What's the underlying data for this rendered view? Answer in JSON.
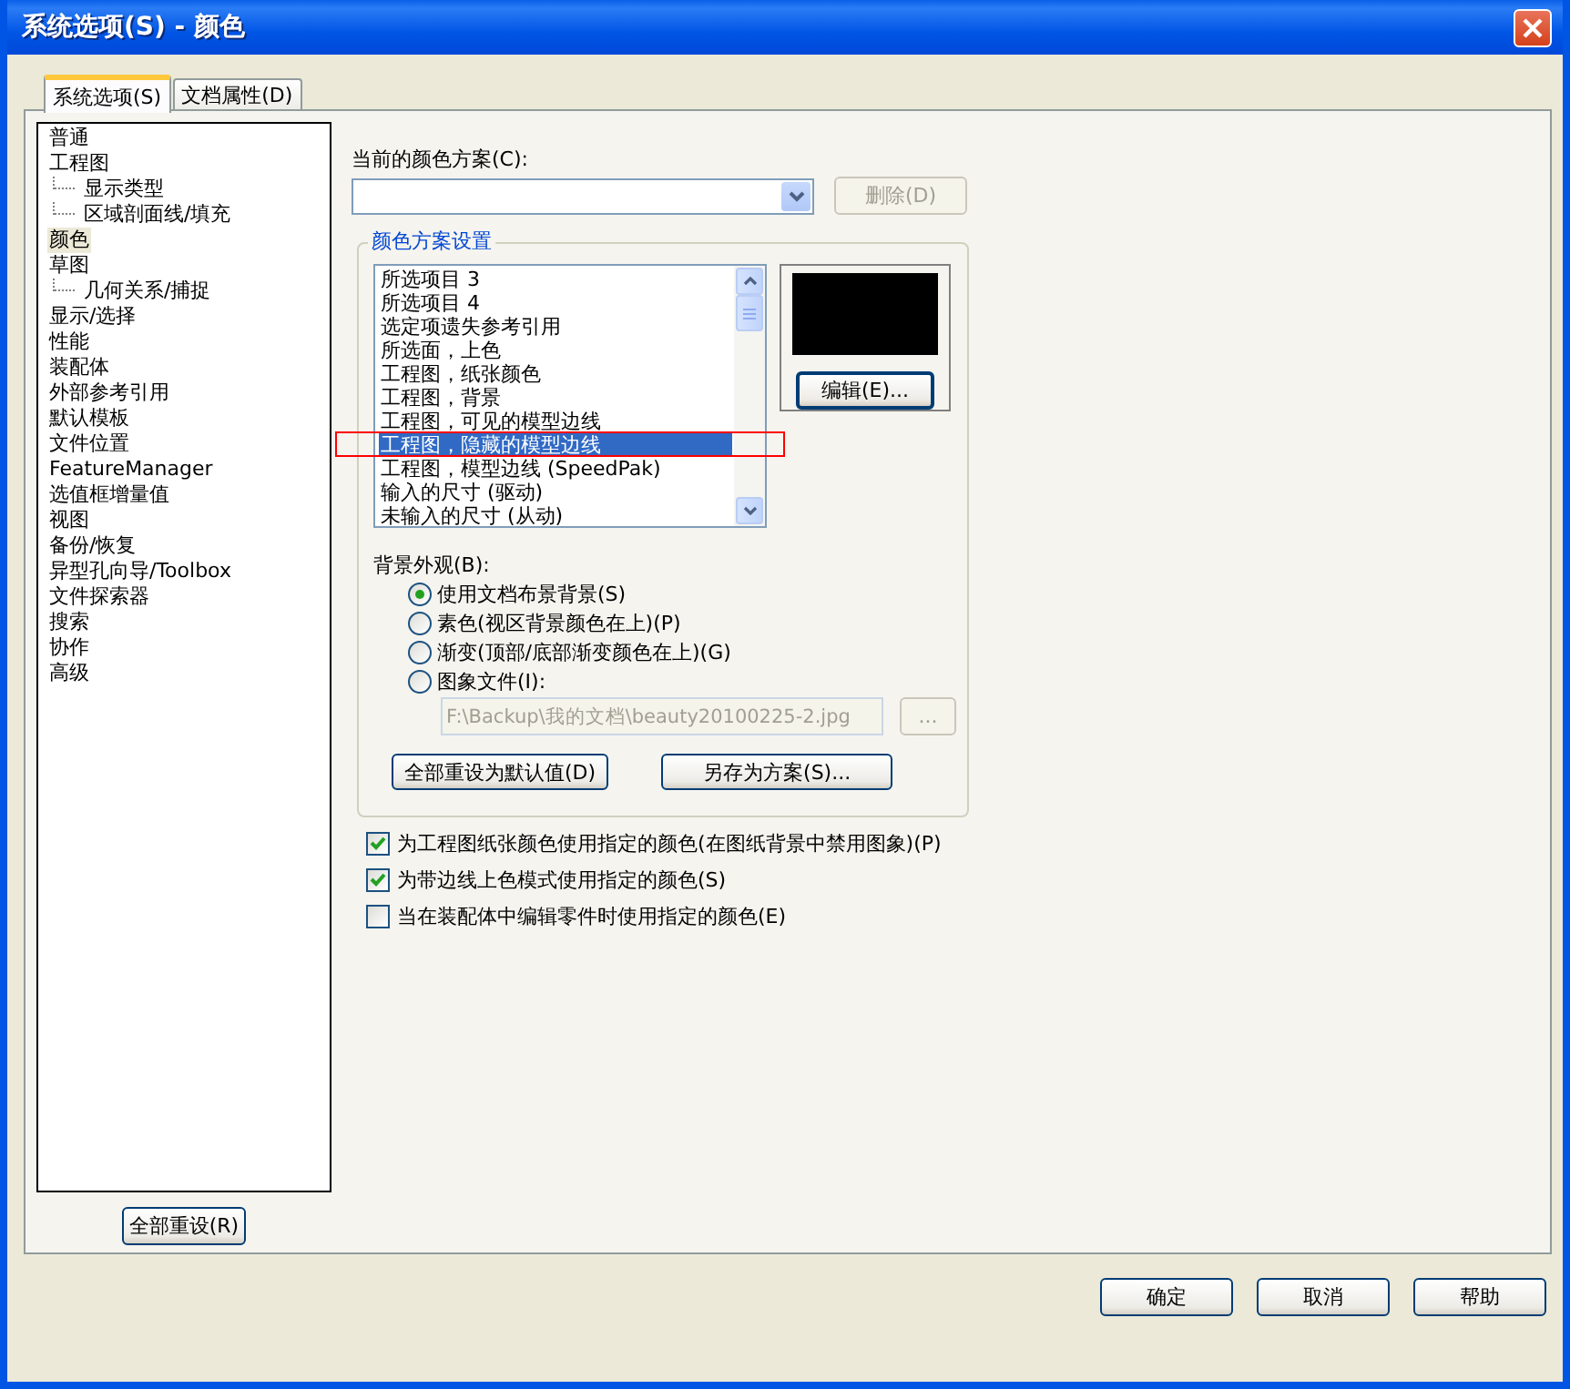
{
  "window": {
    "title": "系统选项(S) - 颜色"
  },
  "tabs": [
    {
      "label": "系统选项(S)",
      "selected": true
    },
    {
      "label": "文档属性(D)",
      "selected": false
    }
  ],
  "sidebar": {
    "items": [
      {
        "label": "普通",
        "selected": false
      },
      {
        "label": "工程图",
        "selected": false,
        "children": [
          {
            "label": "显示类型",
            "selected": false
          },
          {
            "label": "区域剖面线/填充",
            "selected": false
          }
        ]
      },
      {
        "label": "颜色",
        "selected": true
      },
      {
        "label": "草图",
        "selected": false,
        "children": [
          {
            "label": "几何关系/捕捉",
            "selected": false
          }
        ]
      },
      {
        "label": "显示/选择",
        "selected": false
      },
      {
        "label": "性能",
        "selected": false
      },
      {
        "label": "装配体",
        "selected": false
      },
      {
        "label": "外部参考引用",
        "selected": false
      },
      {
        "label": "默认模板",
        "selected": false
      },
      {
        "label": "文件位置",
        "selected": false
      },
      {
        "label": "FeatureManager",
        "selected": false
      },
      {
        "label": "选值框增量值",
        "selected": false
      },
      {
        "label": "视图",
        "selected": false
      },
      {
        "label": "备份/恢复",
        "selected": false
      },
      {
        "label": "异型孔向导/Toolbox",
        "selected": false
      },
      {
        "label": "文件探索器",
        "selected": false
      },
      {
        "label": "搜索",
        "selected": false
      },
      {
        "label": "协作",
        "selected": false
      },
      {
        "label": "高级",
        "selected": false
      }
    ],
    "reset_button": "全部重设(R)"
  },
  "color_scheme": {
    "label": "当前的颜色方案(C):",
    "delete_button": {
      "label": "删除(D)",
      "disabled": true
    }
  },
  "scheme_settings": {
    "title": "颜色方案设置",
    "items": [
      {
        "label": "所选项目 3",
        "selected": false
      },
      {
        "label": "所选项目 4",
        "selected": false
      },
      {
        "label": "选定项遗失参考引用",
        "selected": false
      },
      {
        "label": "所选面，上色",
        "selected": false
      },
      {
        "label": "工程图，纸张颜色",
        "selected": false
      },
      {
        "label": "工程图，背景",
        "selected": false
      },
      {
        "label": "工程图，可见的模型边线",
        "selected": false
      },
      {
        "label": "工程图，隐藏的模型边线",
        "selected": true
      },
      {
        "label": "工程图，模型边线 (SpeedPak)",
        "selected": false
      },
      {
        "label": "输入的尺寸 (驱动)",
        "selected": false
      },
      {
        "label": "未输入的尺寸 (从动)",
        "selected": false
      }
    ],
    "edit_button": "编辑(E)...",
    "background": {
      "label": "背景外观(B):",
      "options": [
        {
          "label": "使用文档布景背景(S)",
          "selected": true
        },
        {
          "label": "素色(视区背景颜色在上)(P)",
          "selected": false
        },
        {
          "label": "渐变(顶部/底部渐变颜色在上)(G)",
          "selected": false
        },
        {
          "label": "图象文件(I):",
          "selected": false
        }
      ],
      "image_path": {
        "value": "F:\\Backup\\我的文档\\beauty20100225-2.jpg",
        "disabled": true
      },
      "browse_button": {
        "label": "...",
        "disabled": true
      }
    },
    "reset_defaults_button": "全部重设为默认值(D)",
    "save_as_button": "另存为方案(S)..."
  },
  "checkboxes": [
    {
      "label": "为工程图纸张颜色使用指定的颜色(在图纸背景中禁用图象)(P)",
      "checked": true
    },
    {
      "label": "为带边线上色模式使用指定的颜色(S)",
      "checked": true
    },
    {
      "label": "当在装配体中编辑零件时使用指定的颜色(E)",
      "checked": false
    }
  ],
  "footer_buttons": [
    "确定",
    "取消",
    "帮助"
  ]
}
